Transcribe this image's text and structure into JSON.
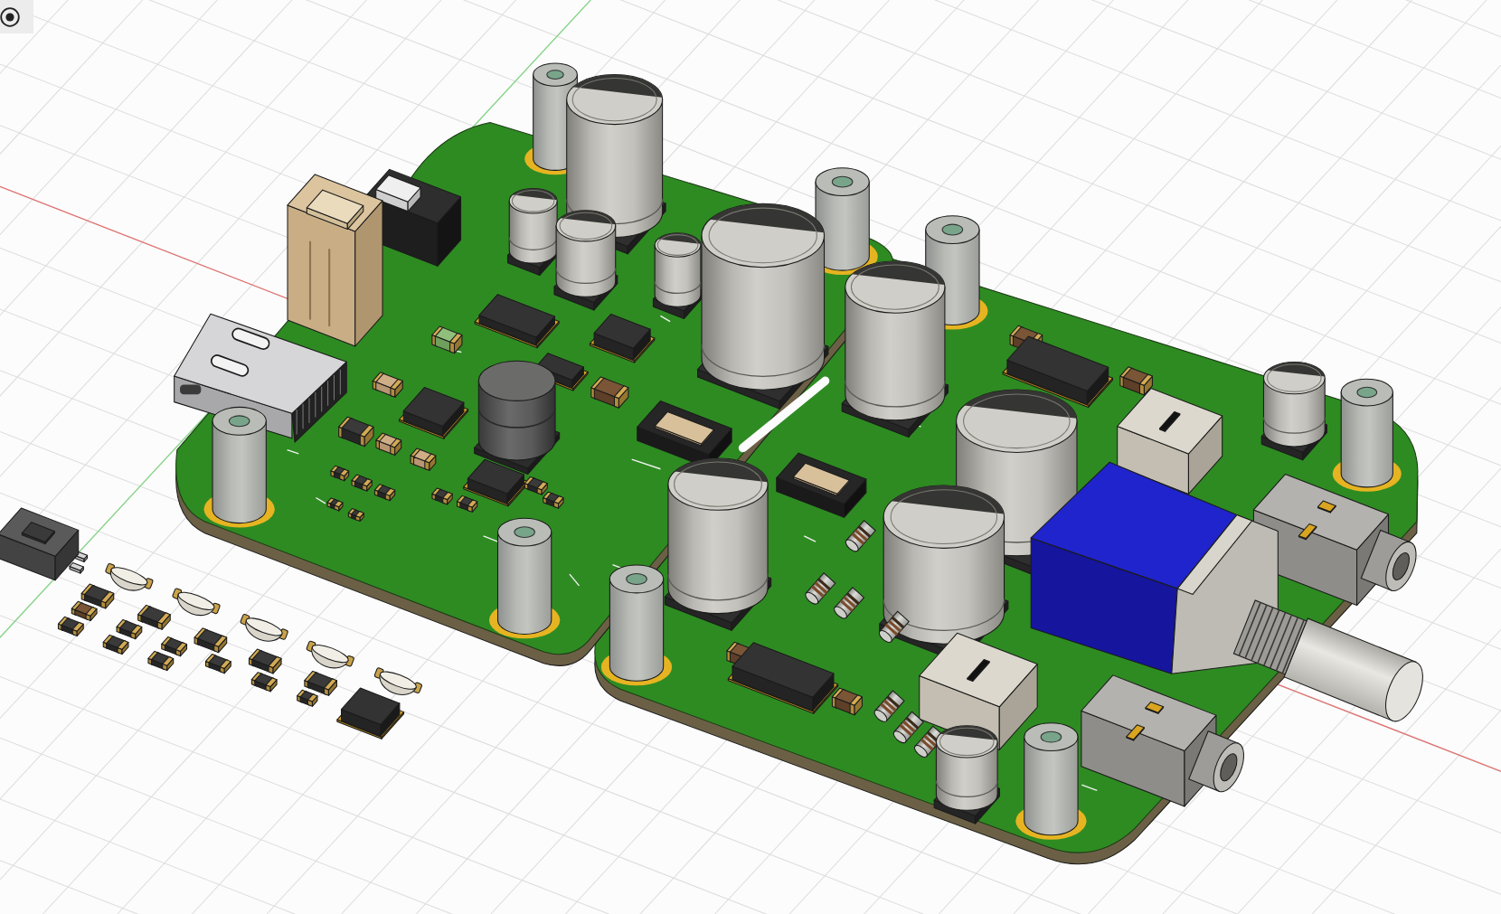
{
  "model": {
    "boards": [
      {
        "parts": [
          {
            "kind": "standoff"
          },
          {
            "kind": "capacitor"
          },
          {
            "kind": "wire-connector"
          },
          {
            "kind": "slide-switch"
          },
          {
            "kind": "capacitor"
          },
          {
            "kind": "capacitor"
          },
          {
            "kind": "capacitor"
          },
          {
            "kind": "standoff"
          },
          {
            "kind": "capacitor"
          },
          {
            "kind": "chip"
          },
          {
            "kind": "chip"
          },
          {
            "kind": "usb-c"
          },
          {
            "kind": "smd"
          },
          {
            "kind": "inductor"
          },
          {
            "kind": "chip"
          },
          {
            "kind": "chip"
          },
          {
            "kind": "smd"
          },
          {
            "kind": "ribbon-connector"
          },
          {
            "kind": "chip"
          },
          {
            "kind": "smd"
          },
          {
            "kind": "smd"
          },
          {
            "kind": "smd"
          },
          {
            "kind": "smd"
          },
          {
            "kind": "smd"
          },
          {
            "kind": "smd"
          },
          {
            "kind": "smd"
          },
          {
            "kind": "smd"
          },
          {
            "kind": "smd"
          },
          {
            "kind": "smd"
          },
          {
            "kind": "smd"
          },
          {
            "kind": "smd"
          },
          {
            "kind": "smd"
          },
          {
            "kind": "standoff"
          },
          {
            "kind": "standoff"
          }
        ]
      },
      {
        "parts": [
          {
            "kind": "standoff"
          },
          {
            "kind": "capacitor"
          },
          {
            "kind": "smd"
          },
          {
            "kind": "chip"
          },
          {
            "kind": "smd"
          },
          {
            "kind": "capacitor"
          },
          {
            "kind": "standoff"
          },
          {
            "kind": "trimmer"
          },
          {
            "kind": "capacitor"
          },
          {
            "kind": "ribbon-connector"
          },
          {
            "kind": "capacitor"
          },
          {
            "kind": "capacitor"
          },
          {
            "kind": "resistor"
          },
          {
            "kind": "resistor"
          },
          {
            "kind": "resistor"
          },
          {
            "kind": "resistor"
          },
          {
            "kind": "audio-jack"
          },
          {
            "kind": "potentiometer"
          },
          {
            "kind": "standoff"
          },
          {
            "kind": "chip"
          },
          {
            "kind": "smd"
          },
          {
            "kind": "smd"
          },
          {
            "kind": "trimmer"
          },
          {
            "kind": "resistor"
          },
          {
            "kind": "resistor"
          },
          {
            "kind": "resistor"
          },
          {
            "kind": "audio-jack"
          },
          {
            "kind": "capacitor"
          },
          {
            "kind": "standoff"
          }
        ]
      }
    ],
    "loose_parts": [
      {
        "kind": "tactile-switch"
      },
      {
        "kind": "led"
      },
      {
        "kind": "smd"
      },
      {
        "kind": "smd"
      },
      {
        "kind": "smd"
      },
      {
        "kind": "led"
      },
      {
        "kind": "smd"
      },
      {
        "kind": "smd"
      },
      {
        "kind": "smd"
      },
      {
        "kind": "led"
      },
      {
        "kind": "smd"
      },
      {
        "kind": "smd"
      },
      {
        "kind": "smd"
      },
      {
        "kind": "smd"
      },
      {
        "kind": "led"
      },
      {
        "kind": "smd"
      },
      {
        "kind": "smd"
      },
      {
        "kind": "led"
      },
      {
        "kind": "smd"
      },
      {
        "kind": "smd"
      },
      {
        "kind": "chip"
      }
    ]
  }
}
